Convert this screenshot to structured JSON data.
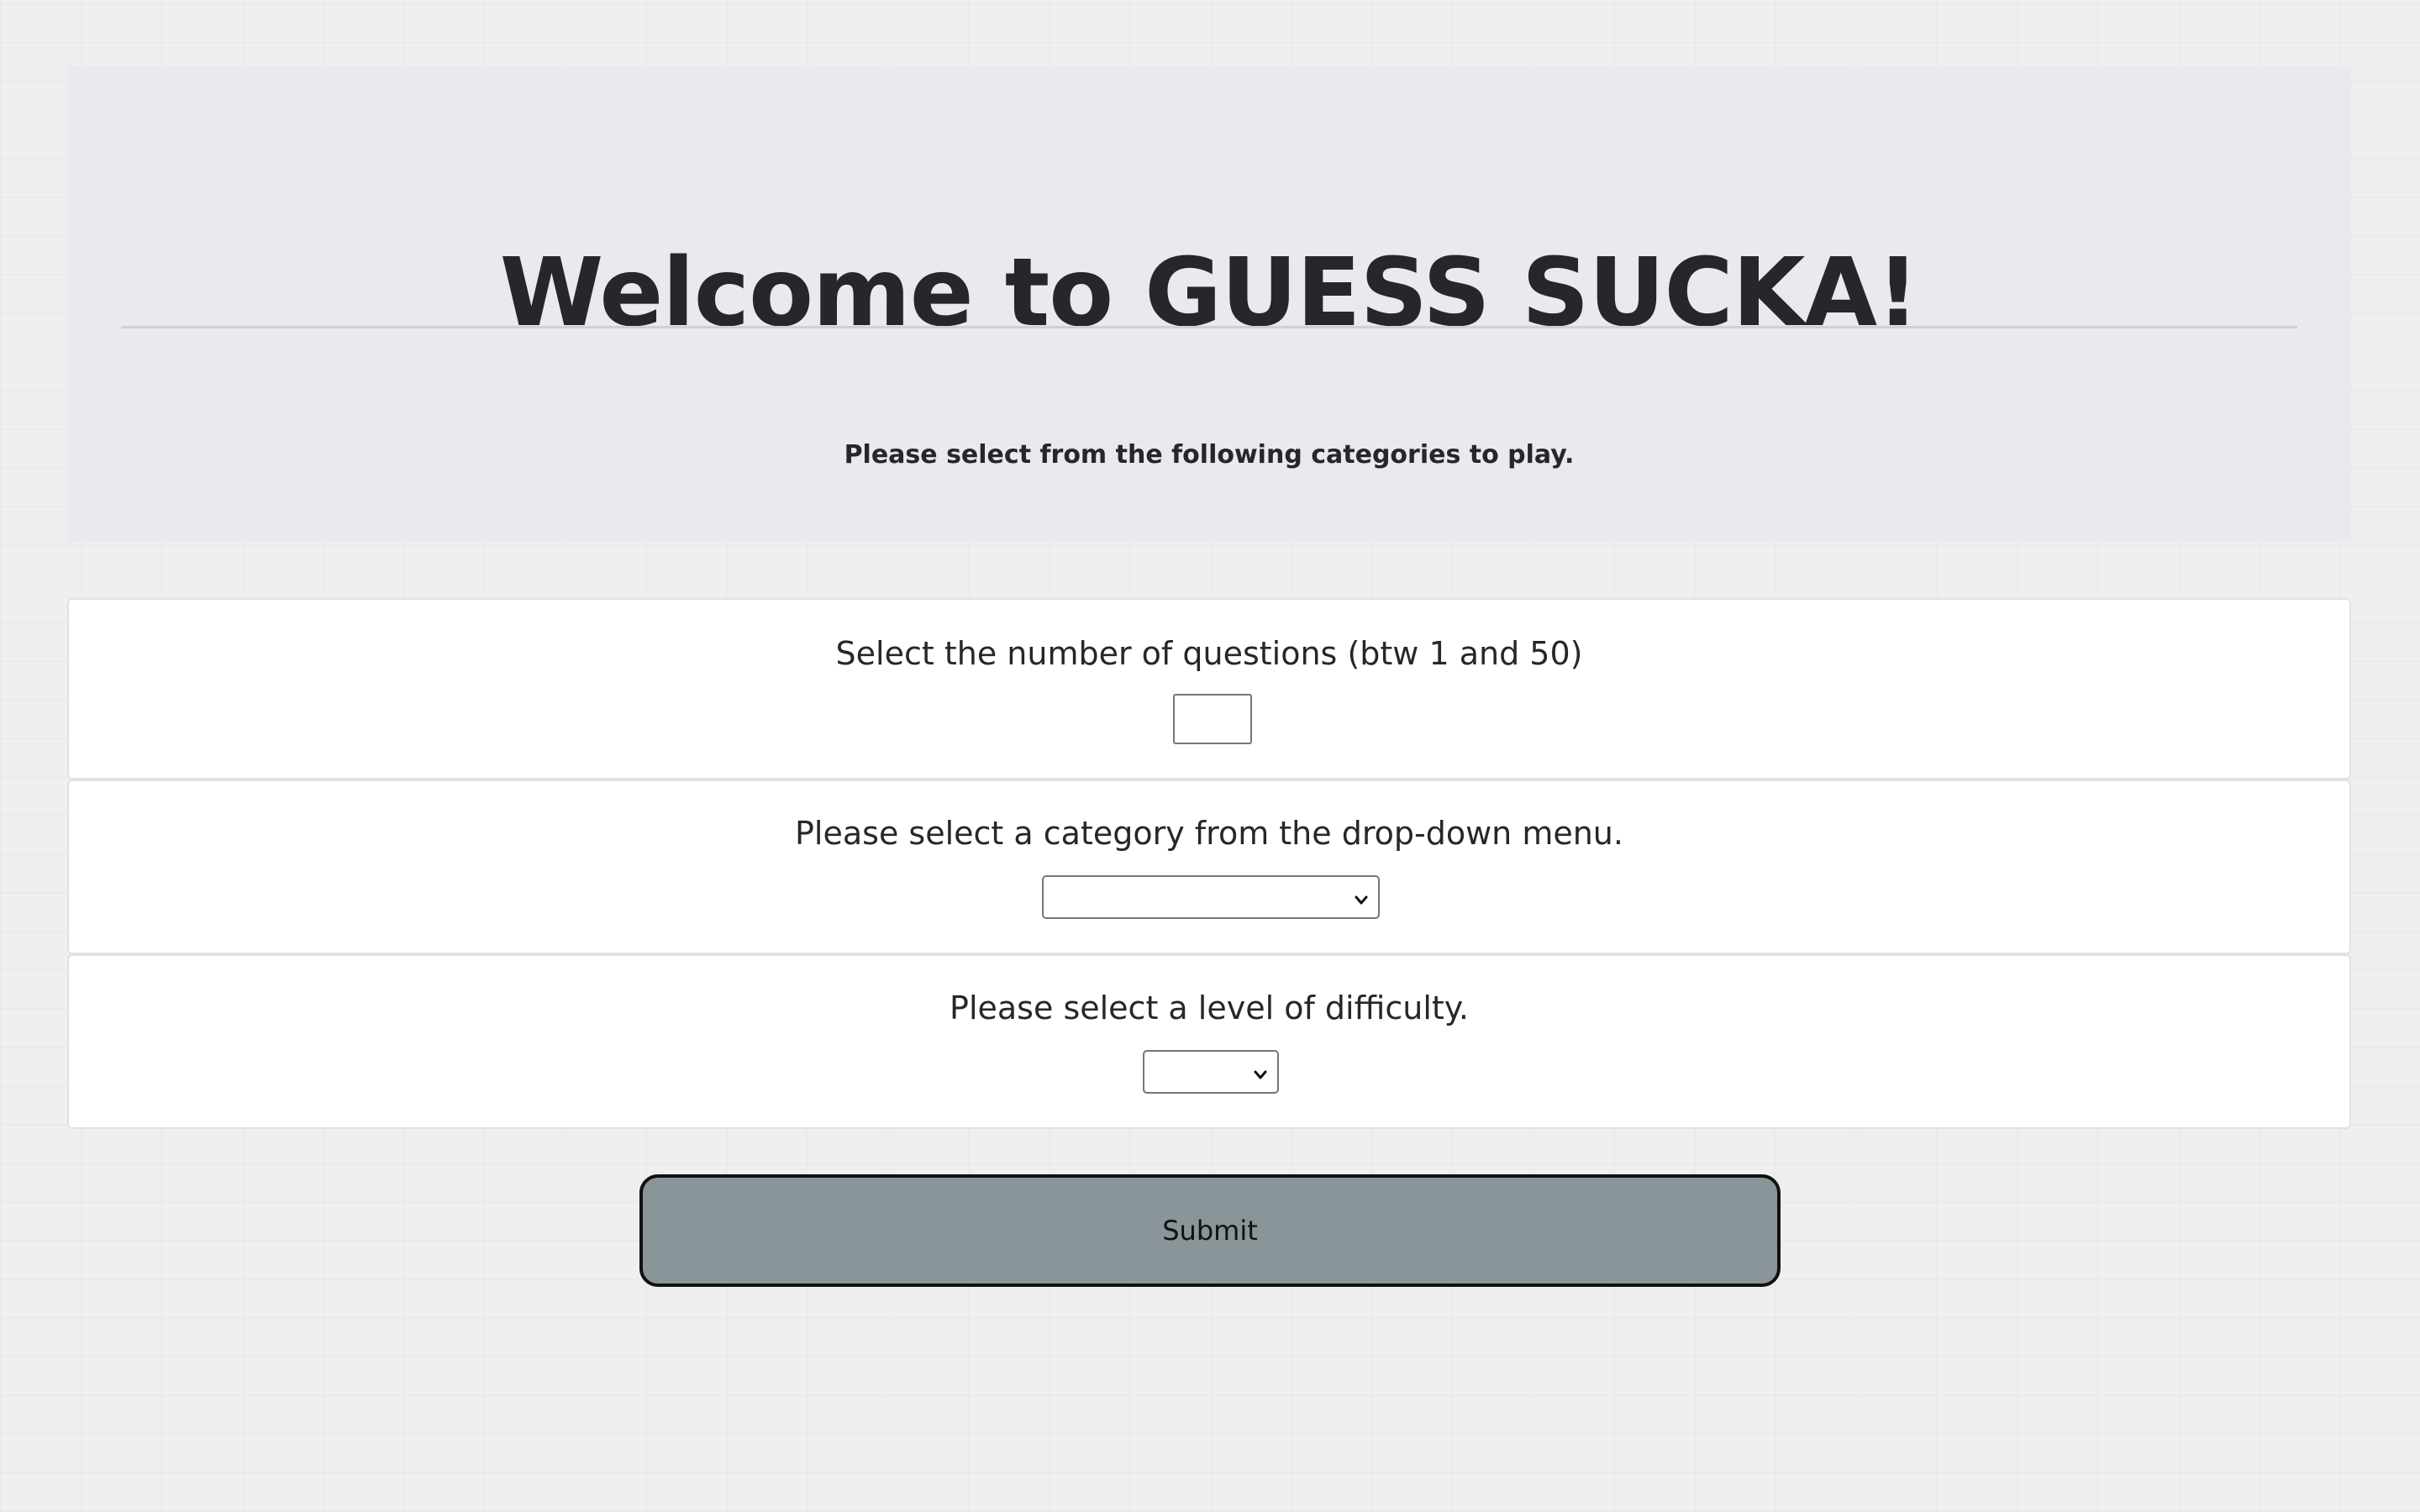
{
  "header": {
    "title": "Welcome to GUESS SUCKA!",
    "lead": "Please select from the following categories to play."
  },
  "questions": {
    "label": "Select the number of questions (btw 1 and 50)",
    "value": ""
  },
  "category": {
    "label": "Please select a category from the drop-down menu.",
    "selected": ""
  },
  "difficulty": {
    "label": "Please select a level of difficulty.",
    "selected": ""
  },
  "submit": {
    "label": "Submit"
  },
  "colors": {
    "background": "#efefef",
    "jumbotron": "#e9eaed",
    "card": "#ffffff",
    "button": "#899598",
    "text": "#25272b"
  },
  "icons": {
    "select_arrow": "chevron-down-icon"
  }
}
